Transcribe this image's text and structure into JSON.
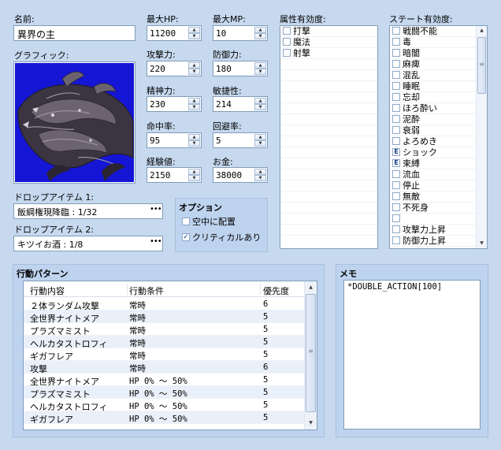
{
  "name": {
    "label": "名前:",
    "value": "異界の主"
  },
  "graphic": {
    "label": "グラフィック:"
  },
  "stats": {
    "maxhp": {
      "label": "最大HP:",
      "value": "11200"
    },
    "maxmp": {
      "label": "最大MP:",
      "value": "10"
    },
    "atk": {
      "label": "攻撃力:",
      "value": "220"
    },
    "def": {
      "label": "防御力:",
      "value": "180"
    },
    "spi": {
      "label": "精神力:",
      "value": "230"
    },
    "agi": {
      "label": "敏捷性:",
      "value": "214"
    },
    "hit": {
      "label": "命中率:",
      "value": "95"
    },
    "eva": {
      "label": "回避率:",
      "value": "5"
    },
    "exp": {
      "label": "経験値:",
      "value": "2150"
    },
    "gold": {
      "label": "お金:",
      "value": "38000"
    }
  },
  "drops": {
    "item1": {
      "label": "ドロップアイテム 1:",
      "value": "飯綱権現降臨 : 1/32"
    },
    "item2": {
      "label": "ドロップアイテム 2:",
      "value": "キツイお酒 : 1/8"
    }
  },
  "options": {
    "title": "オプション",
    "items": [
      {
        "label": "空中に配置",
        "checked": false
      },
      {
        "label": "クリティカルあり",
        "checked": true
      }
    ]
  },
  "element": {
    "title": "属性有効度:",
    "items": [
      "打撃",
      "魔法",
      "射撃"
    ]
  },
  "state": {
    "title": "ステート有効度:",
    "items": [
      {
        "label": "戦闘不能",
        "mark": ""
      },
      {
        "label": "毒",
        "mark": ""
      },
      {
        "label": "暗闇",
        "mark": ""
      },
      {
        "label": "麻痺",
        "mark": ""
      },
      {
        "label": "混乱",
        "mark": ""
      },
      {
        "label": "睡眠",
        "mark": ""
      },
      {
        "label": "忘却",
        "mark": ""
      },
      {
        "label": "ほろ酔い",
        "mark": ""
      },
      {
        "label": "泥酔",
        "mark": ""
      },
      {
        "label": "衰弱",
        "mark": ""
      },
      {
        "label": "よろめき",
        "mark": ""
      },
      {
        "label": "ショック",
        "mark": "E"
      },
      {
        "label": "束縛",
        "mark": "E"
      },
      {
        "label": "流血",
        "mark": ""
      },
      {
        "label": "停止",
        "mark": ""
      },
      {
        "label": "無敵",
        "mark": ""
      },
      {
        "label": "不死身",
        "mark": ""
      },
      {
        "label": "",
        "mark": ""
      },
      {
        "label": "攻撃力上昇",
        "mark": ""
      },
      {
        "label": "防御力上昇",
        "mark": ""
      }
    ]
  },
  "actions": {
    "title": "行動パターン",
    "headers": [
      "行動内容",
      "行動条件",
      "優先度"
    ],
    "rows": [
      [
        "２体ランダム攻撃",
        "常時",
        "6"
      ],
      [
        "全世界ナイトメア",
        "常時",
        "5"
      ],
      [
        "プラズマミスト",
        "常時",
        "5"
      ],
      [
        "ヘルカタストロフィ",
        "常時",
        "5"
      ],
      [
        "ギガフレア",
        "常時",
        "5"
      ],
      [
        "攻撃",
        "常時",
        "6"
      ],
      [
        "全世界ナイトメア",
        "HP 0% ～ 50%",
        "5"
      ],
      [
        "プラズマミスト",
        "HP 0% ～ 50%",
        "5"
      ],
      [
        "ヘルカタストロフィ",
        "HP 0% ～ 50%",
        "5"
      ],
      [
        "ギガフレア",
        "HP 0% ～ 50%",
        "5"
      ]
    ]
  },
  "memo": {
    "title": "メモ",
    "value": "*DOUBLE_ACTION[100]"
  },
  "colors": {
    "background": "#c7d9ef",
    "graphic_bg": "#1515d6"
  },
  "icons": {
    "spin_up": "triangle-up",
    "spin_down": "triangle-down",
    "ellipsis": "ellipsis-icon"
  }
}
